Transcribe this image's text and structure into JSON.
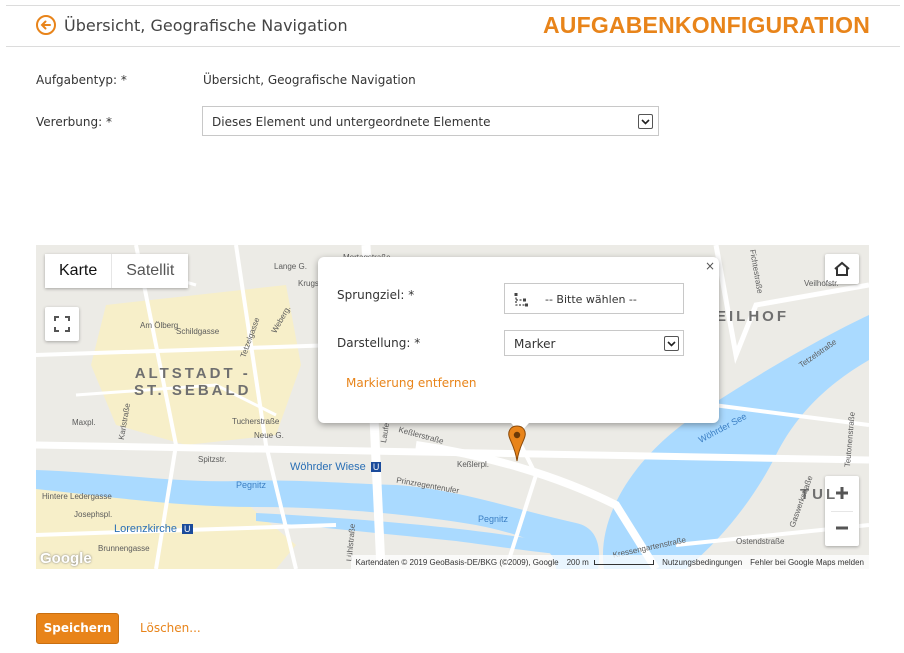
{
  "header": {
    "page_title": "Übersicht, Geografische Navigation",
    "section_title": "AUFGABENKONFIGURATION",
    "back_icon": "circle-arrow-left-icon"
  },
  "form": {
    "task_type_label": "Aufgabentyp: *",
    "task_type_value": "Übersicht, Geografische Navigation",
    "inheritance_label": "Vererbung: *",
    "inheritance_value": "Dieses Element und untergeordnete Elemente"
  },
  "map": {
    "type_tabs": [
      "Karte",
      "Satellit"
    ],
    "active_tab": "Karte",
    "districts": [
      "ALTSTADT -",
      "ST. SEBALD"
    ],
    "district_right": "EILHOF",
    "district_far_right": "TUL",
    "pois": [
      "Wöhrder Wiese",
      "Lorenzkirche"
    ],
    "streets": {
      "s1": "Mortagstraße",
      "s2": "Am Ölberg",
      "s3": "Schildgasse",
      "s4": "Tetzelgasse",
      "s5": "Weberg.",
      "s6": "Lange G.",
      "s7": "Krugstr.",
      "s8": "Maxpl.",
      "s9": "Karlstraße",
      "s10": "Tucherstraße",
      "s11": "Neue G.",
      "s12": "Hintere Ledergasse",
      "s13": "Josephspl.",
      "s14": "Brunnengasse",
      "s15": "Pegnitz",
      "s16": "Pegnitz",
      "s17": "Laufer",
      "s18": "Keßlerstraße",
      "s19": "Keßlerpl.",
      "s20": "Prinzregentenufer",
      "s21": "Wöhrder See",
      "s22": "Kressengartenstraße",
      "s23": "Ostendstraße",
      "s24": "Fichtestraße",
      "s25": "Veilhofstr.",
      "s26": "Tetzelstraße",
      "s27": "Teutonenstraße",
      "s28": "Gaswerkstraße",
      "s29": "Lühlstraße",
      "s30": "Spitzstr."
    },
    "attribution": {
      "data": "Kartendaten © 2019 GeoBasis-DE/BKG (©2009), Google",
      "scale": "200 m",
      "terms": "Nutzungsbedingungen",
      "report": "Fehler bei Google Maps melden"
    },
    "google_logo": "Google",
    "colors": {
      "water": "#aadaff",
      "land": "#ecebe6",
      "oldtown": "#f7efc9",
      "marker": "#e8841a"
    }
  },
  "popup": {
    "target_label": "Sprungziel: *",
    "target_value": "-- Bitte wählen --",
    "display_label": "Darstellung: *",
    "display_value": "Marker",
    "remove_link": "Markierung entfernen",
    "close_symbol": "×"
  },
  "actions": {
    "save_label": "Speichern",
    "delete_label": "Löschen..."
  },
  "accent": "#e8841a"
}
